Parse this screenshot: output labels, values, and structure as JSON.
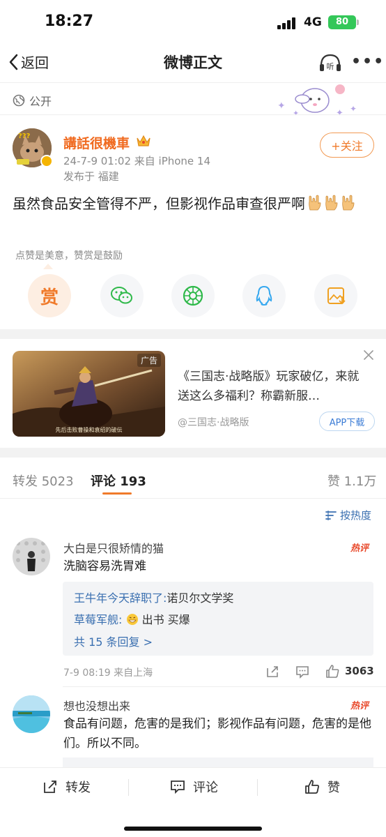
{
  "status": {
    "time": "18:27",
    "network": "4G",
    "battery": "80"
  },
  "nav": {
    "back_label": "返回",
    "title": "微博正文",
    "listen_label": "听"
  },
  "post": {
    "visibility": "公开",
    "username": "講話很機車",
    "time_source": "24-7-9 01:02  来自 iPhone 14",
    "location": "发布于 福建",
    "follow_label": "+关注",
    "text": "虽然食品安全管得不严，但影视作品审查很严啊"
  },
  "reward": {
    "hint": "点赞是美意，赞赏是鼓励",
    "reward_glyph": "赏",
    "share_icons": [
      "reward-icon",
      "wechat-icon",
      "moments-icon",
      "qq-icon",
      "save-image-icon"
    ]
  },
  "ad": {
    "tag": "广告",
    "title": "《三国志·战略版》玩家破亿，来就送这么多福利？称霸新服…",
    "source": "@三国志·战略版",
    "button": "APP下载",
    "caption": "先后击败曹操和袁绍的破伝"
  },
  "tabs": {
    "repost_label": "转发",
    "repost_count": "5023",
    "comment_label": "评论",
    "comment_count": "193",
    "like_label": "赞",
    "like_count": "1.1万",
    "sort_label": "按热度"
  },
  "comments": [
    {
      "name": "大白是只很矫情的猫",
      "badge": "热评",
      "text": "洗脑容易洗胃难",
      "replies": [
        {
          "user": "王牛年今天辞职了:",
          "text": "诺贝尔文学奖"
        },
        {
          "user": "草莓军舰:",
          "text": "出书 买爆"
        }
      ],
      "more_replies": "共 15 条回复 >",
      "meta": "7-9 08:19  来自上海",
      "likes": "3063"
    },
    {
      "name": "想也没想出来",
      "badge": "热评",
      "text": "食品有问题，危害的是我们；影视作品有问题，危害的是他们。所以不同。"
    }
  ],
  "bottom": {
    "repost": "转发",
    "comment": "评论",
    "like": "赞"
  },
  "colors": {
    "accent": "#f07a2a",
    "link": "#3a6fb0",
    "hot": "#e8492b",
    "battery": "#34c759"
  }
}
